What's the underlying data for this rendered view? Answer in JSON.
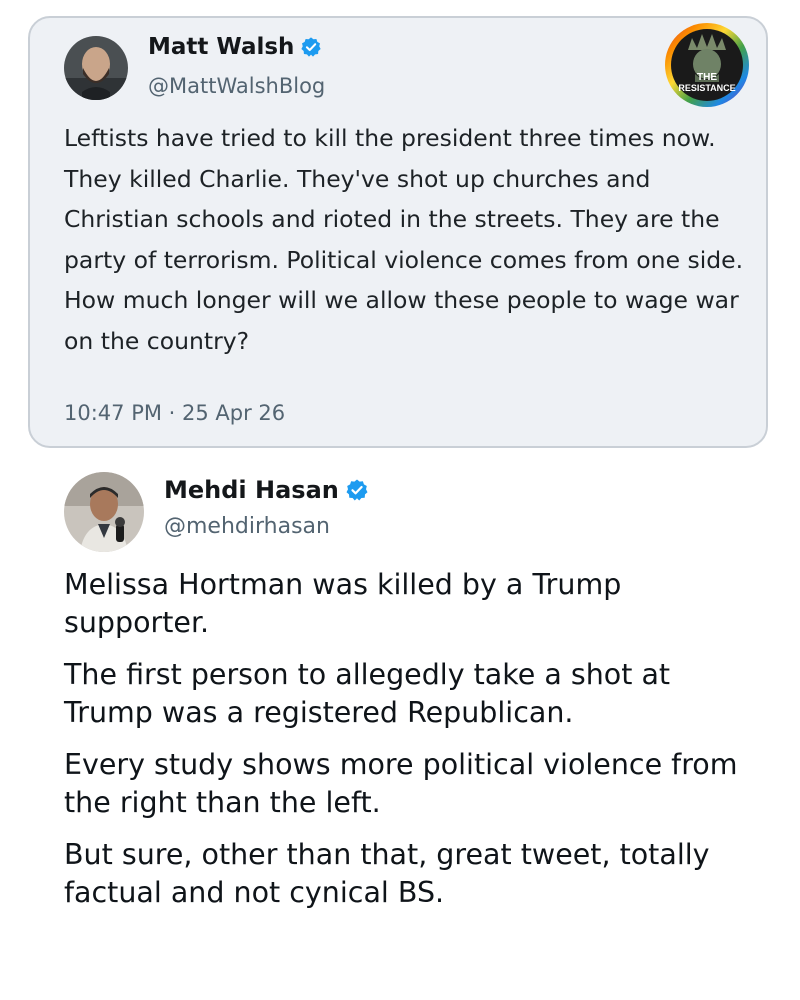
{
  "quoted_tweet": {
    "author": {
      "display_name": "Matt Walsh",
      "handle": "@MattWalshBlog",
      "verified": true,
      "avatar_icon": "bald-bearded-man-avatar"
    },
    "text": "Leftists have tried to kill the president three times now. They killed Charlie. They've shot up churches and Christian schools and rioted in the streets. They are the party of terrorism. Political violence comes from one side. How much longer will we allow these people to wage war on the country?",
    "timestamp": "10:47 PM · 25 Apr 26"
  },
  "watermark": {
    "line1": "THE",
    "line2": "RESISTANCE",
    "icon": "statue-of-liberty-rainbow-logo"
  },
  "reply_tweet": {
    "author": {
      "display_name": "Mehdi Hasan",
      "handle": "@mehdirhasan",
      "verified": true,
      "avatar_icon": "man-speaking-microphone-avatar"
    },
    "paragraphs": [
      "Melissa Hortman was killed by a Trump supporter.",
      "The first person to allegedly take a shot at Trump was a registered Republican.",
      "Every study shows more political violence from the right than the left.",
      "But sure, other than that, great tweet, totally factual and not cynical BS."
    ]
  },
  "colors": {
    "verified_badge": "#1d9bf0",
    "quoted_background": "#eef1f5",
    "quoted_border": "#c9cfd6",
    "secondary_text": "#536471",
    "primary_text": "#0f1419"
  }
}
